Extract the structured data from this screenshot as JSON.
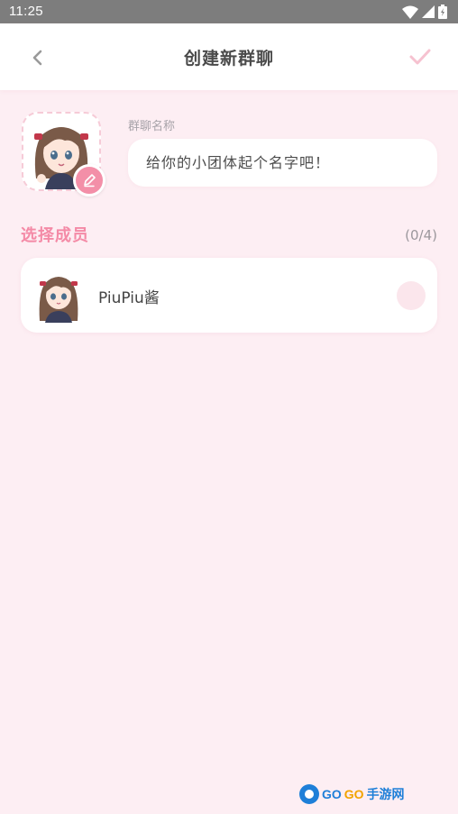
{
  "status_bar": {
    "time": "11:25"
  },
  "nav": {
    "title": "创建新群聊"
  },
  "group": {
    "name_label": "群聊名称",
    "name_placeholder": "给你的小团体起个名字吧！"
  },
  "members": {
    "section_title": "选择成员",
    "count": "(0/4)",
    "items": [
      {
        "name": "PiuPiu酱",
        "selected": false
      }
    ]
  },
  "watermark": {
    "brand_go1": "GO",
    "brand_go2": "GO",
    "brand_cn": "手游网"
  },
  "colors": {
    "accent": "#f48aa6",
    "background": "#fdeef3",
    "confirm": "#f6c2d0"
  },
  "icons": [
    "wifi-icon",
    "signal-icon",
    "battery-icon",
    "back-arrow-icon",
    "checkmark-icon",
    "pencil-icon"
  ]
}
